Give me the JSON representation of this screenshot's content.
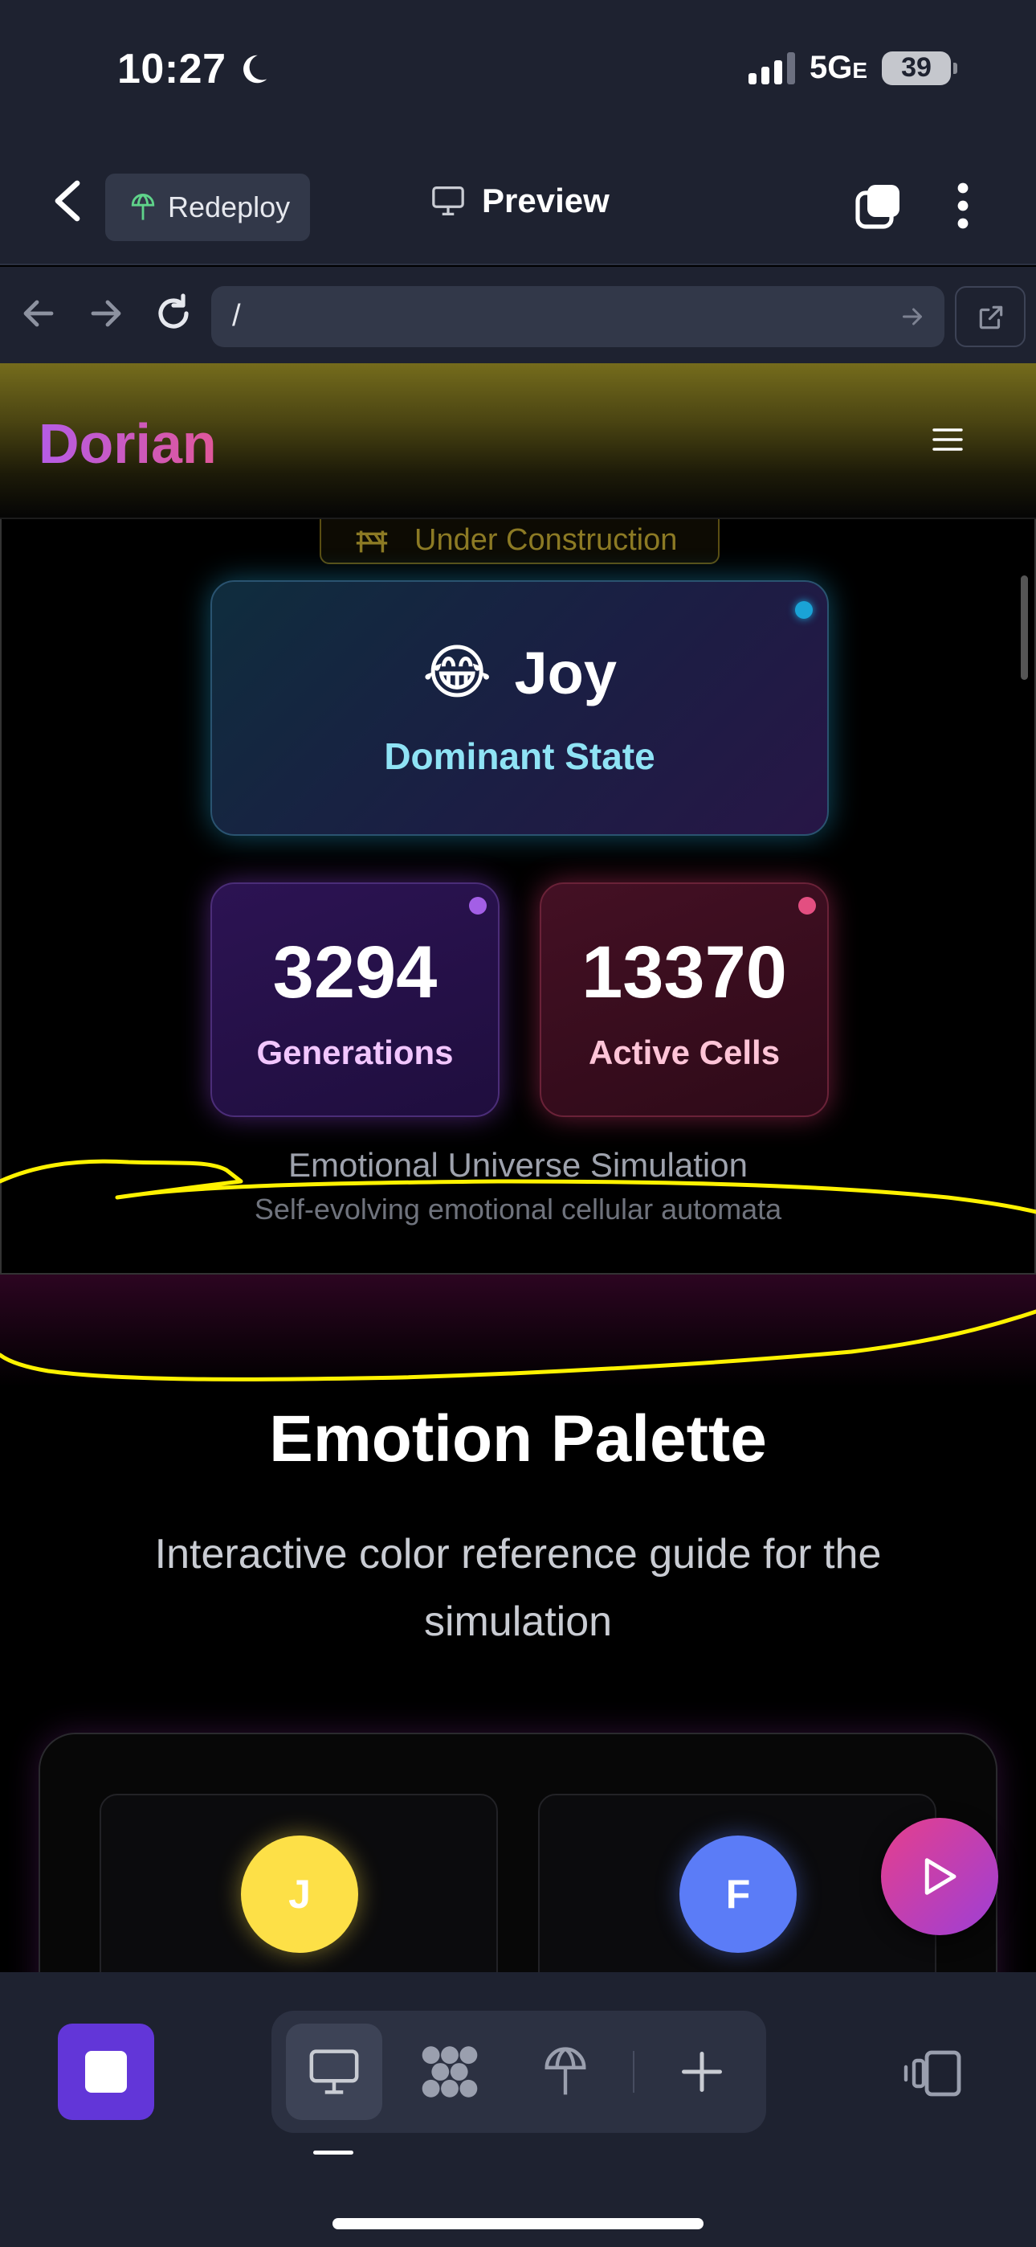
{
  "status_bar": {
    "time": "10:27",
    "network": "5G",
    "network_suffix": "E",
    "battery": "39"
  },
  "app_header": {
    "redeploy_label": "Redeploy",
    "preview_label": "Preview"
  },
  "browser": {
    "url": "/"
  },
  "site": {
    "brand": "Dorian",
    "construction_label": "Under Construction",
    "dominant": {
      "emoji": "😂",
      "name": "Joy",
      "label": "Dominant State"
    },
    "stats": [
      {
        "value": "3294",
        "label": "Generations",
        "color": "#f2c6ff",
        "dot_color": "#a35fe6"
      },
      {
        "value": "13370",
        "label": "Active Cells",
        "color": "#ffc4d7",
        "dot_color": "#e34f81"
      }
    ],
    "simulation_title": "Emotional Universe Simulation",
    "simulation_subtitle": "Self-evolving emotional cellular automata",
    "palette": {
      "title": "Emotion Palette",
      "subtitle": "Interactive color reference guide for the simulation",
      "swatches": [
        {
          "letter": "J",
          "color": "#fde047"
        },
        {
          "letter": "F",
          "color": "#5b7cf7"
        }
      ]
    }
  },
  "colors": {
    "accent": "#6236d8",
    "joy_dot": "#1aa3d6",
    "annotation": "#fff200"
  }
}
